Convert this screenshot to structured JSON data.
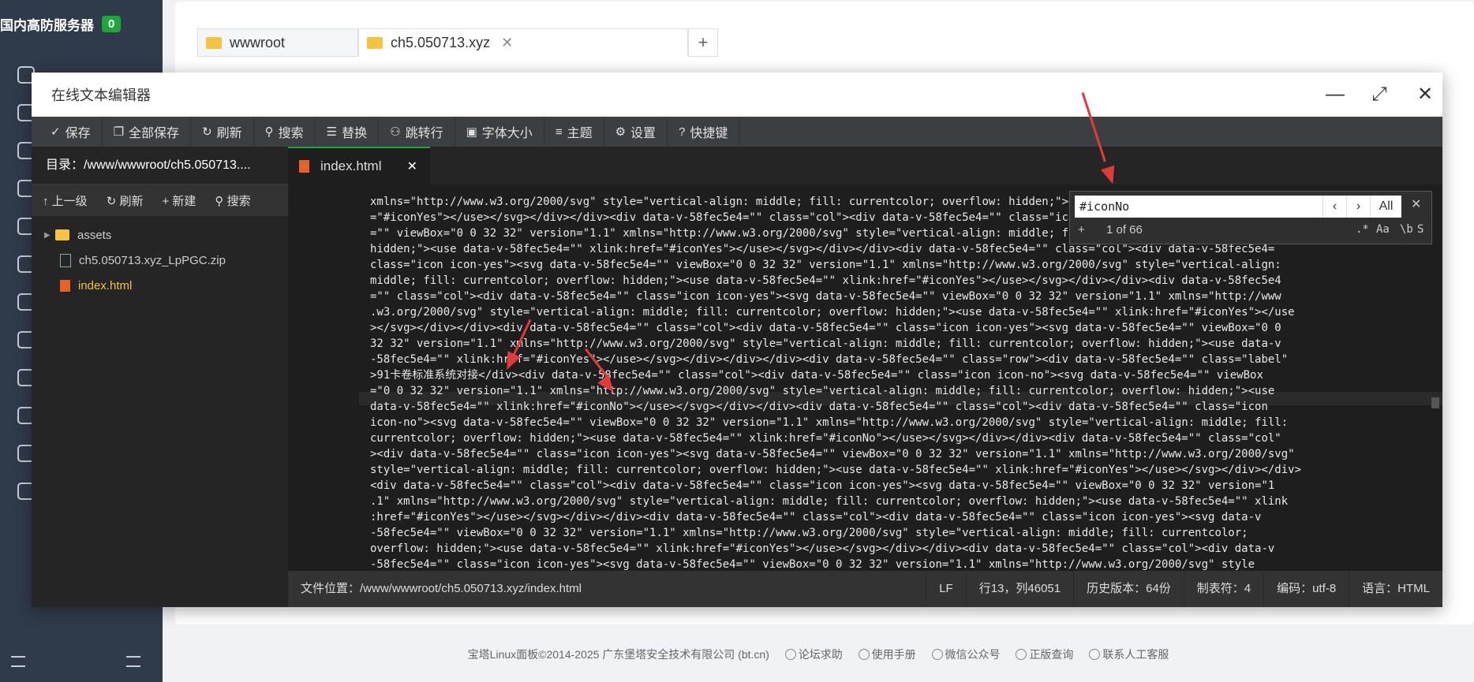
{
  "sidebar": {
    "brand": "国内高防服务器",
    "badge": "0"
  },
  "top_tabs": [
    {
      "label": "wwwroot"
    },
    {
      "label": "ch5.050713.xyz"
    }
  ],
  "editor": {
    "title": "在线文本编辑器",
    "toolbar": [
      "保存",
      "全部保存",
      "刷新",
      "搜索",
      "替换",
      "跳转行",
      "字体大小",
      "主题",
      "设置",
      "快捷键"
    ],
    "directory": "目录：/www/wwwroot/ch5.050713....",
    "dir_actions": [
      "上一级",
      "刷新",
      "新建",
      "搜索"
    ],
    "tree": [
      "assets",
      "ch5.050713.xyz_LpPGC.zip",
      "index.html"
    ],
    "open_tab": "index.html",
    "code_lines": [
      "xmlns=\"http://www.w3.org/2000/svg\" style=\"vertical-align: middle; fill: currentcolor; overflow: hidden;\"><use data-v-58fec5e4=\"\" xlink:href=",
      "=\"#iconYes\"></use></svg></div></div><div data-v-58fec5e4=\"\" class=\"col\"><div data-v-58fec5e4=\"\" class=\"icon icon-yes\"><svg data-v-58fec5e4",
      "=\"\" viewBox=\"0 0 32 32\" version=\"1.1\" xmlns=\"http://www.w3.org/2000/svg\" style=\"vertical-align: middle; fill: currentcolor; overflow:",
      "hidden;\"><use data-v-58fec5e4=\"\" xlink:href=\"#iconYes\"></use></svg></div></div><div data-v-58fec5e4=\"\" class=\"col\"><div data-v-58fec5e4=",
      "class=\"icon icon-yes\"><svg data-v-58fec5e4=\"\" viewBox=\"0 0 32 32\" version=\"1.1\" xmlns=\"http://www.w3.org/2000/svg\" style=\"vertical-align:",
      "middle; fill: currentcolor; overflow: hidden;\"><use data-v-58fec5e4=\"\" xlink:href=\"#iconYes\"></use></svg></div></div><div data-v-58fec5e4",
      "=\"\" class=\"col\"><div data-v-58fec5e4=\"\" class=\"icon icon-yes\"><svg data-v-58fec5e4=\"\" viewBox=\"0 0 32 32\" version=\"1.1\" xmlns=\"http://www",
      ".w3.org/2000/svg\" style=\"vertical-align: middle; fill: currentcolor; overflow: hidden;\"><use data-v-58fec5e4=\"\" xlink:href=\"#iconYes\"></use",
      "></svg></div></div><div data-v-58fec5e4=\"\" class=\"col\"><div data-v-58fec5e4=\"\" class=\"icon icon-yes\"><svg data-v-58fec5e4=\"\" viewBox=\"0 0",
      "32 32\" version=\"1.1\" xmlns=\"http://www.w3.org/2000/svg\" style=\"vertical-align: middle; fill: currentcolor; overflow: hidden;\"><use data-v",
      "-58fec5e4=\"\" xlink:href=\"#iconYes\"></use></svg></div></div></div><div data-v-58fec5e4=\"\" class=\"row\"><div data-v-58fec5e4=\"\" class=\"label\"",
      ">91卡卷标准系统对接</div><div data-v-58fec5e4=\"\" class=\"col\"><div data-v-58fec5e4=\"\" class=\"icon icon-no\"><svg data-v-58fec5e4=\"\" viewBox",
      "=\"0 0 32 32\" version=\"1.1\" xmlns=\"http://www.w3.org/2000/svg\" style=\"vertical-align: middle; fill: currentcolor; overflow: hidden;\"><use",
      "data-v-58fec5e4=\"\" xlink:href=\"#iconNo\"></use></svg></div></div><div data-v-58fec5e4=\"\" class=\"col\"><div data-v-58fec5e4=\"\" class=\"icon",
      "icon-no\"><svg data-v-58fec5e4=\"\" viewBox=\"0 0 32 32\" version=\"1.1\" xmlns=\"http://www.w3.org/2000/svg\" style=\"vertical-align: middle; fill:",
      "currentcolor; overflow: hidden;\"><use data-v-58fec5e4=\"\" xlink:href=\"#iconNo\"></use></svg></div></div><div data-v-58fec5e4=\"\" class=\"col\"",
      "><div data-v-58fec5e4=\"\" class=\"icon icon-yes\"><svg data-v-58fec5e4=\"\" viewBox=\"0 0 32 32\" version=\"1.1\" xmlns=\"http://www.w3.org/2000/svg\"",
      "style=\"vertical-align: middle; fill: currentcolor; overflow: hidden;\"><use data-v-58fec5e4=\"\" xlink:href=\"#iconYes\"></use></svg></div></div>",
      "<div data-v-58fec5e4=\"\" class=\"col\"><div data-v-58fec5e4=\"\" class=\"icon icon-yes\"><svg data-v-58fec5e4=\"\" viewBox=\"0 0 32 32\" version=\"1",
      ".1\" xmlns=\"http://www.w3.org/2000/svg\" style=\"vertical-align: middle; fill: currentcolor; overflow: hidden;\"><use data-v-58fec5e4=\"\" xlink",
      ":href=\"#iconYes\"></use></svg></div></div><div data-v-58fec5e4=\"\" class=\"col\"><div data-v-58fec5e4=\"\" class=\"icon icon-yes\"><svg data-v",
      "-58fec5e4=\"\" viewBox=\"0 0 32 32\" version=\"1.1\" xmlns=\"http://www.w3.org/2000/svg\" style=\"vertical-align: middle; fill: currentcolor;",
      "overflow: hidden;\"><use data-v-58fec5e4=\"\" xlink:href=\"#iconYes\"></use></svg></div></div><div data-v-58fec5e4=\"\" class=\"col\"><div data-v",
      "-58fec5e4=\"\" class=\"icon icon-yes\"><svg data-v-58fec5e4=\"\" viewBox=\"0 0 32 32\" version=\"1.1\" xmlns=\"http://www.w3.org/2000/svg\" style"
    ],
    "status": {
      "path": "文件位置：/www/wwwroot/ch5.050713.xyz/index.html",
      "eol": "LF",
      "cursor": "行13，列46051",
      "history": "历史版本：64份",
      "tab": "制表符：4",
      "encoding": "编码：utf-8",
      "language": "语言：HTML"
    },
    "search": {
      "value": "#iconNo",
      "count": "1 of 66",
      "all_label": "All"
    }
  },
  "footer": {
    "copyright": "宝塔Linux面板©2014-2025 广东堡塔安全技术有限公司 (bt.cn)",
    "links": [
      "论坛求助",
      "使用手册",
      "微信公众号",
      "正版查询",
      "联系人工客服"
    ]
  },
  "colors": {
    "accent": "#20a53a",
    "annotation": "#e03b3b",
    "editor_bg": "#1e1e1e"
  }
}
